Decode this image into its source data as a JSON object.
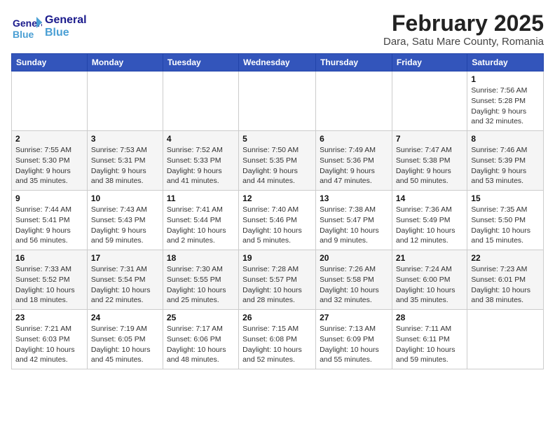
{
  "logo": {
    "line1": "General",
    "line2": "Blue"
  },
  "title": "February 2025",
  "subtitle": "Dara, Satu Mare County, Romania",
  "weekdays": [
    "Sunday",
    "Monday",
    "Tuesday",
    "Wednesday",
    "Thursday",
    "Friday",
    "Saturday"
  ],
  "weeks": [
    [
      {
        "day": "",
        "info": ""
      },
      {
        "day": "",
        "info": ""
      },
      {
        "day": "",
        "info": ""
      },
      {
        "day": "",
        "info": ""
      },
      {
        "day": "",
        "info": ""
      },
      {
        "day": "",
        "info": ""
      },
      {
        "day": "1",
        "info": "Sunrise: 7:56 AM\nSunset: 5:28 PM\nDaylight: 9 hours and 32 minutes."
      }
    ],
    [
      {
        "day": "2",
        "info": "Sunrise: 7:55 AM\nSunset: 5:30 PM\nDaylight: 9 hours and 35 minutes."
      },
      {
        "day": "3",
        "info": "Sunrise: 7:53 AM\nSunset: 5:31 PM\nDaylight: 9 hours and 38 minutes."
      },
      {
        "day": "4",
        "info": "Sunrise: 7:52 AM\nSunset: 5:33 PM\nDaylight: 9 hours and 41 minutes."
      },
      {
        "day": "5",
        "info": "Sunrise: 7:50 AM\nSunset: 5:35 PM\nDaylight: 9 hours and 44 minutes."
      },
      {
        "day": "6",
        "info": "Sunrise: 7:49 AM\nSunset: 5:36 PM\nDaylight: 9 hours and 47 minutes."
      },
      {
        "day": "7",
        "info": "Sunrise: 7:47 AM\nSunset: 5:38 PM\nDaylight: 9 hours and 50 minutes."
      },
      {
        "day": "8",
        "info": "Sunrise: 7:46 AM\nSunset: 5:39 PM\nDaylight: 9 hours and 53 minutes."
      }
    ],
    [
      {
        "day": "9",
        "info": "Sunrise: 7:44 AM\nSunset: 5:41 PM\nDaylight: 9 hours and 56 minutes."
      },
      {
        "day": "10",
        "info": "Sunrise: 7:43 AM\nSunset: 5:43 PM\nDaylight: 9 hours and 59 minutes."
      },
      {
        "day": "11",
        "info": "Sunrise: 7:41 AM\nSunset: 5:44 PM\nDaylight: 10 hours and 2 minutes."
      },
      {
        "day": "12",
        "info": "Sunrise: 7:40 AM\nSunset: 5:46 PM\nDaylight: 10 hours and 5 minutes."
      },
      {
        "day": "13",
        "info": "Sunrise: 7:38 AM\nSunset: 5:47 PM\nDaylight: 10 hours and 9 minutes."
      },
      {
        "day": "14",
        "info": "Sunrise: 7:36 AM\nSunset: 5:49 PM\nDaylight: 10 hours and 12 minutes."
      },
      {
        "day": "15",
        "info": "Sunrise: 7:35 AM\nSunset: 5:50 PM\nDaylight: 10 hours and 15 minutes."
      }
    ],
    [
      {
        "day": "16",
        "info": "Sunrise: 7:33 AM\nSunset: 5:52 PM\nDaylight: 10 hours and 18 minutes."
      },
      {
        "day": "17",
        "info": "Sunrise: 7:31 AM\nSunset: 5:54 PM\nDaylight: 10 hours and 22 minutes."
      },
      {
        "day": "18",
        "info": "Sunrise: 7:30 AM\nSunset: 5:55 PM\nDaylight: 10 hours and 25 minutes."
      },
      {
        "day": "19",
        "info": "Sunrise: 7:28 AM\nSunset: 5:57 PM\nDaylight: 10 hours and 28 minutes."
      },
      {
        "day": "20",
        "info": "Sunrise: 7:26 AM\nSunset: 5:58 PM\nDaylight: 10 hours and 32 minutes."
      },
      {
        "day": "21",
        "info": "Sunrise: 7:24 AM\nSunset: 6:00 PM\nDaylight: 10 hours and 35 minutes."
      },
      {
        "day": "22",
        "info": "Sunrise: 7:23 AM\nSunset: 6:01 PM\nDaylight: 10 hours and 38 minutes."
      }
    ],
    [
      {
        "day": "23",
        "info": "Sunrise: 7:21 AM\nSunset: 6:03 PM\nDaylight: 10 hours and 42 minutes."
      },
      {
        "day": "24",
        "info": "Sunrise: 7:19 AM\nSunset: 6:05 PM\nDaylight: 10 hours and 45 minutes."
      },
      {
        "day": "25",
        "info": "Sunrise: 7:17 AM\nSunset: 6:06 PM\nDaylight: 10 hours and 48 minutes."
      },
      {
        "day": "26",
        "info": "Sunrise: 7:15 AM\nSunset: 6:08 PM\nDaylight: 10 hours and 52 minutes."
      },
      {
        "day": "27",
        "info": "Sunrise: 7:13 AM\nSunset: 6:09 PM\nDaylight: 10 hours and 55 minutes."
      },
      {
        "day": "28",
        "info": "Sunrise: 7:11 AM\nSunset: 6:11 PM\nDaylight: 10 hours and 59 minutes."
      },
      {
        "day": "",
        "info": ""
      }
    ]
  ]
}
